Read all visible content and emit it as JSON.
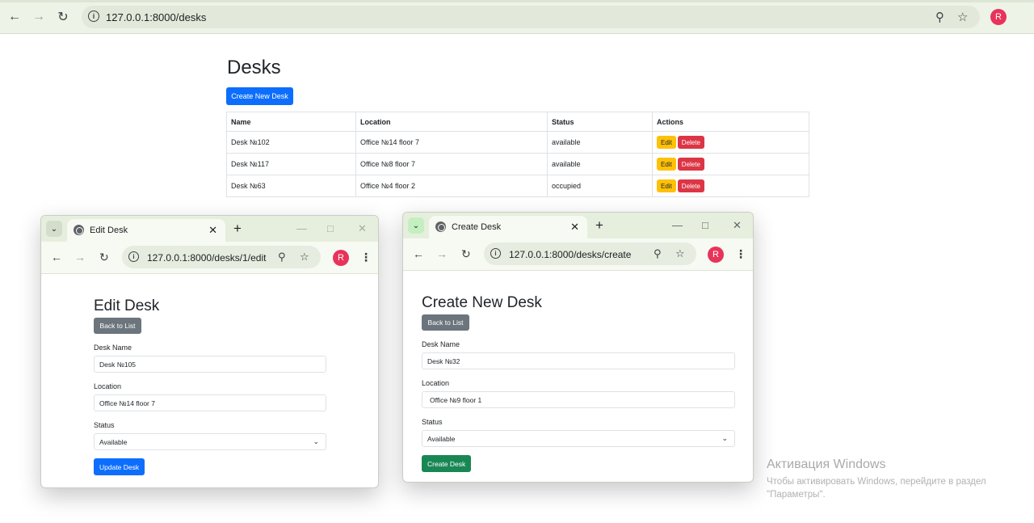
{
  "browser": {
    "url": "127.0.0.1:8000/desks",
    "profile_initial": "R",
    "icons": {
      "back": "back-arrow-icon",
      "forward": "forward-arrow-icon",
      "reload": "reload-icon",
      "info": "site-info-icon",
      "zoom": "zoom-icon",
      "bookmark": "star-icon"
    }
  },
  "main": {
    "title": "Desks",
    "create_button": "Create New Desk",
    "table": {
      "headers": [
        "Name",
        "Location",
        "Status",
        "Actions"
      ],
      "rows": [
        {
          "name": "Desk №102",
          "location": "Office №14 floor 7",
          "status": "available"
        },
        {
          "name": "Desk №117",
          "location": "Office №8 floor 7",
          "status": "available"
        },
        {
          "name": "Desk №63",
          "location": "Office №4 floor 2",
          "status": "occupied"
        }
      ],
      "edit_label": "Edit",
      "delete_label": "Delete"
    }
  },
  "edit_window": {
    "tab_title": "Edit Desk",
    "url": "127.0.0.1:8000/desks/1/edit",
    "profile_initial": "R",
    "form_title": "Edit Desk",
    "back_button": "Back to List",
    "name_label": "Desk Name",
    "name_value": "Desk №105",
    "location_label": "Location",
    "location_value": "Office №14   floor 7",
    "status_label": "Status",
    "status_value": "Available",
    "submit_button": "Update Desk"
  },
  "create_window": {
    "tab_title": "Create Desk",
    "url": "127.0.0.1:8000/desks/create",
    "profile_initial": "R",
    "form_title": "Create New Desk",
    "back_button": "Back to List",
    "name_label": "Desk Name",
    "name_value": "Desk №32",
    "location_label": "Location",
    "location_value": "Office №9   floor 1",
    "status_label": "Status",
    "status_value": "Available",
    "submit_button": "Create Desk"
  },
  "watermark": {
    "title": "Активация Windows",
    "line1": "Чтобы активировать Windows, перейдите в раздел",
    "line2": "\"Параметры\"."
  },
  "colors": {
    "primary": "#0d6efd",
    "secondary": "#6c757d",
    "success": "#198754",
    "warning": "#ffc107",
    "danger": "#dc3545",
    "avatar": "#e8335a"
  }
}
